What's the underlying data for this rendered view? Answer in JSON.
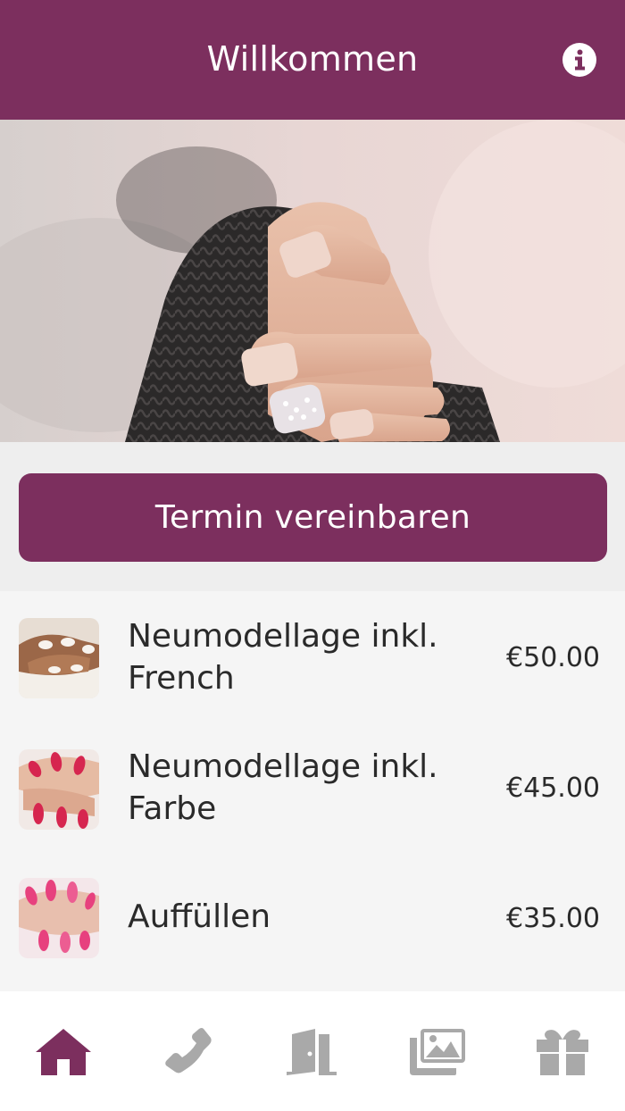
{
  "header": {
    "title": "Willkommen",
    "info_icon": "info-circle-icon"
  },
  "hero": {
    "image": "manicured-hand-photo"
  },
  "cta": {
    "label": "Termin vereinbaren"
  },
  "services": [
    {
      "name": "Neumodellage inkl. French",
      "price": "€50.00",
      "thumb": "french-nails-photo"
    },
    {
      "name": "Neumodellage inkl. Farbe",
      "price": "€45.00",
      "thumb": "red-nails-photo"
    },
    {
      "name": "Auffüllen",
      "price": "€35.00",
      "thumb": "pink-nails-photo"
    }
  ],
  "tabbar": {
    "tabs": [
      {
        "icon": "home-icon",
        "active": true
      },
      {
        "icon": "phone-icon",
        "active": false
      },
      {
        "icon": "door-icon",
        "active": false
      },
      {
        "icon": "gallery-icon",
        "active": false
      },
      {
        "icon": "gift-icon",
        "active": false
      }
    ]
  },
  "colors": {
    "brand": "#7c2f5e",
    "inactive_icon": "#a9a9a9"
  }
}
